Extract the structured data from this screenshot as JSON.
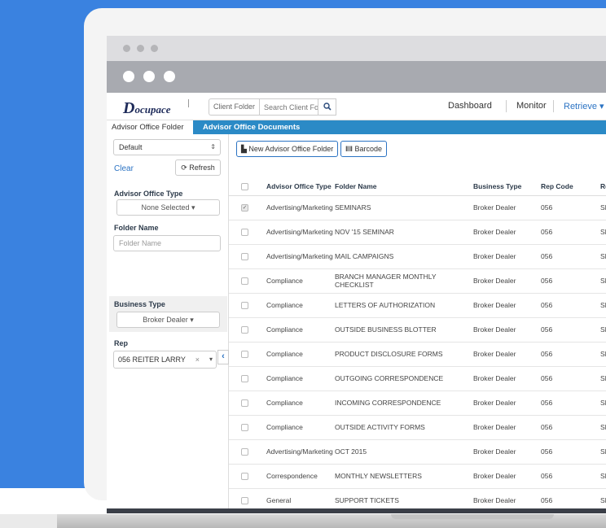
{
  "app": {
    "logo": "ocupace",
    "logo_initial": "D"
  },
  "search": {
    "folder_label": "Client Folder",
    "placeholder": "Search Client Folder"
  },
  "nav": {
    "items": [
      "Dashboard",
      "Monitor",
      "Retrieve ▾"
    ]
  },
  "tabs": [
    "Advisor Office Folder",
    "Advisor Office Documents"
  ],
  "sidebar": {
    "view_select": "Default",
    "clear": "Clear",
    "refresh": "Refresh",
    "office_type_label": "Advisor Office Type",
    "office_type_value": "None Selected ▾",
    "folder_name_label": "Folder Name",
    "folder_name_placeholder": "Folder Name",
    "business_type_label": "Business Type",
    "business_type_value": "Broker Dealer ▾",
    "rep_label": "Rep",
    "rep_value": "056 REITER LARRY",
    "rep_clear": "×",
    "collapse": "‹"
  },
  "toolbar": {
    "new_folder": "New Advisor Office Folder",
    "barcode": "Barcode"
  },
  "table": {
    "columns": [
      "Advisor Office Type",
      "Folder Name",
      "Business Type",
      "Rep Code",
      "Re"
    ],
    "rows": [
      {
        "checked": true,
        "type": "Advertising/Marketing",
        "folder": "SEMINARS",
        "business": "Broker Dealer",
        "rep": "056",
        "re": "SM"
      },
      {
        "checked": false,
        "type": "Advertising/Marketing",
        "folder": "NOV '15 SEMINAR",
        "business": "Broker Dealer",
        "rep": "056",
        "re": "SM"
      },
      {
        "checked": false,
        "type": "Advertising/Marketing",
        "folder": "MAIL CAMPAIGNS",
        "business": "Broker Dealer",
        "rep": "056",
        "re": "SM"
      },
      {
        "checked": false,
        "type": "Compliance",
        "folder": "BRANCH MANAGER MONTHLY CHECKLIST",
        "business": "Broker Dealer",
        "rep": "056",
        "re": "SM"
      },
      {
        "checked": false,
        "type": "Compliance",
        "folder": "LETTERS OF AUTHORIZATION",
        "business": "Broker Dealer",
        "rep": "056",
        "re": "SM"
      },
      {
        "checked": false,
        "type": "Compliance",
        "folder": "OUTSIDE BUSINESS BLOTTER",
        "business": "Broker Dealer",
        "rep": "056",
        "re": "SM"
      },
      {
        "checked": false,
        "type": "Compliance",
        "folder": "PRODUCT DISCLOSURE FORMS",
        "business": "Broker Dealer",
        "rep": "056",
        "re": "SM"
      },
      {
        "checked": false,
        "type": "Compliance",
        "folder": "OUTGOING CORRESPONDENCE",
        "business": "Broker Dealer",
        "rep": "056",
        "re": "SM"
      },
      {
        "checked": false,
        "type": "Compliance",
        "folder": "INCOMING CORRESPONDENCE",
        "business": "Broker Dealer",
        "rep": "056",
        "re": "SM"
      },
      {
        "checked": false,
        "type": "Compliance",
        "folder": "OUTSIDE ACTIVITY FORMS",
        "business": "Broker Dealer",
        "rep": "056",
        "re": "SM"
      },
      {
        "checked": false,
        "type": "Advertising/Marketing",
        "folder": "OCT 2015",
        "business": "Broker Dealer",
        "rep": "056",
        "re": "SM"
      },
      {
        "checked": false,
        "type": "Correspondence",
        "folder": "MONTHLY NEWSLETTERS",
        "business": "Broker Dealer",
        "rep": "056",
        "re": "SM"
      },
      {
        "checked": false,
        "type": "General",
        "folder": "SUPPORT TICKETS",
        "business": "Broker Dealer",
        "rep": "056",
        "re": "SM"
      }
    ]
  },
  "colors": {
    "background": "#3a82e0",
    "tabbar": "#2b8ac6",
    "accent": "#2b73c3"
  }
}
